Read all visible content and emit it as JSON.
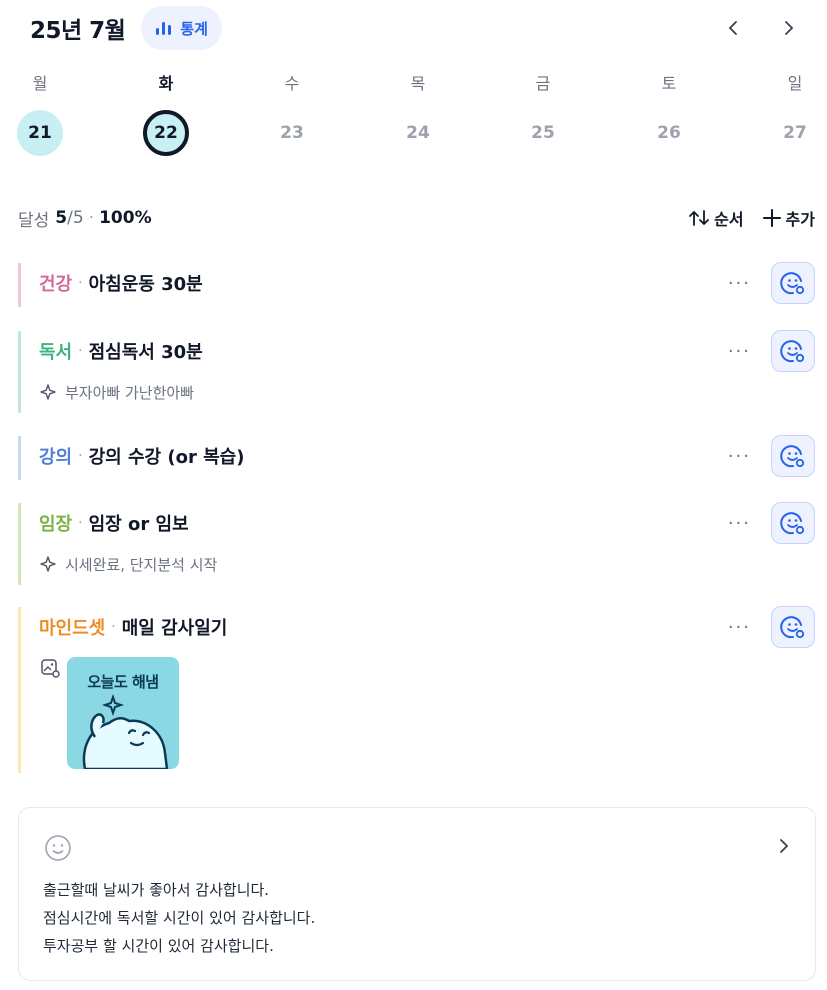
{
  "header": {
    "month_title": "25년 7월",
    "stats_label": "통계",
    "prev_icon": "chevron-left-icon",
    "next_icon": "chevron-right-icon"
  },
  "week": {
    "days": [
      {
        "label": "월",
        "date": "21",
        "state": "done"
      },
      {
        "label": "화",
        "date": "22",
        "state": "today"
      },
      {
        "label": "수",
        "date": "23",
        "state": "future"
      },
      {
        "label": "목",
        "date": "24",
        "state": "future"
      },
      {
        "label": "금",
        "date": "25",
        "state": "future"
      },
      {
        "label": "토",
        "date": "26",
        "state": "future"
      },
      {
        "label": "일",
        "date": "27",
        "state": "future"
      }
    ]
  },
  "summary": {
    "label": "달성",
    "done": "5",
    "total": "/5",
    "dot": "·",
    "percent": "100%",
    "order_label": "순서",
    "add_label": "추가"
  },
  "tasks": [
    {
      "category": "건강",
      "color": "#d46a9a",
      "title": "아침운동 30분",
      "note": ""
    },
    {
      "category": "독서",
      "color": "#3fb37f",
      "title": "점심독서 30분",
      "note": "부자아빠 가난한아빠"
    },
    {
      "category": "강의",
      "color": "#4f7fd9",
      "title": "강의 수강 (or 복습)",
      "note": ""
    },
    {
      "category": "임장",
      "color": "#7cb342",
      "title": "임장 or 임보",
      "note": "시세완료, 단지분석 시작"
    },
    {
      "category": "마인드셋",
      "color": "#f08a24",
      "title": "매일 감사일기",
      "note": "",
      "image_text": "오늘도 해냄"
    }
  ],
  "task_sep": "·",
  "more_label": "···",
  "journal": {
    "lines": [
      "출근할때 날씨가 좋아서 감사합니다.",
      "점심시간에 독서할 시간이 있어 감사합니다.",
      "투자공부 할 시간이 있어 감사합니다."
    ]
  },
  "colors": {
    "accent": "#2563eb",
    "done_day": "#c8f0f4",
    "border_health": "#f2c4d9",
    "border_reading": "#bfe8d4",
    "border_lecture": "#c9d8f2",
    "border_visit": "#cfe8b5",
    "border_mindset": "#fde6b3"
  }
}
